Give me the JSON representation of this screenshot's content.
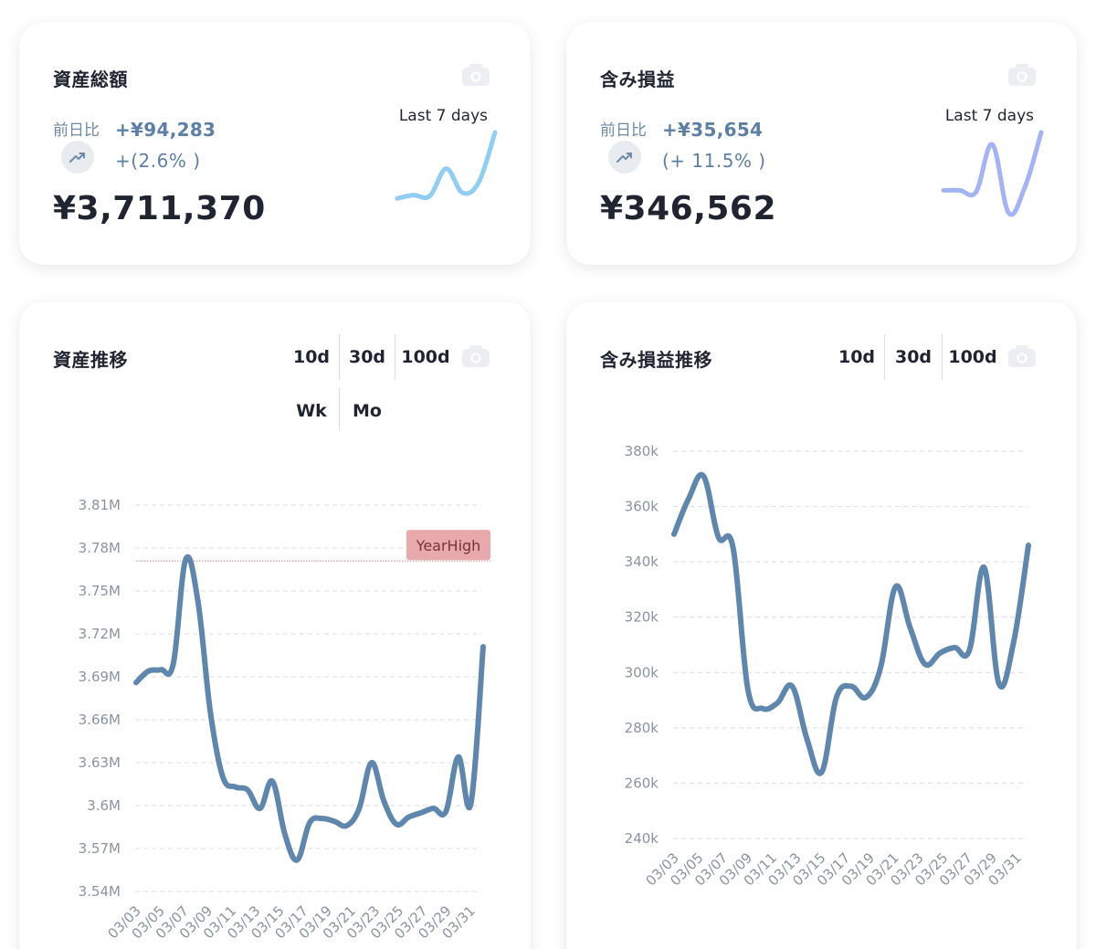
{
  "cards": {
    "assets": {
      "title": "資産総額",
      "delta_label": "前日比",
      "delta_value": "+¥94,283",
      "delta_pct": "+(2.6% )",
      "value": "¥3,711,370",
      "spark_label": "Last 7 days",
      "spark_color": "#90cdf4",
      "spark_values": [
        0.18,
        0.22,
        0.21,
        0.55,
        0.25,
        0.38,
        1.0
      ]
    },
    "pl": {
      "title": "含み損益",
      "delta_label": "前日比",
      "delta_value": "+¥35,654",
      "delta_pct": "(+ 11.5% )",
      "value": "¥346,562",
      "spark_label": "Last 7 days",
      "spark_color": "#a3b3f5",
      "spark_values": [
        0.28,
        0.28,
        0.26,
        0.85,
        0.0,
        0.32,
        1.0
      ]
    }
  },
  "assets_trend": {
    "title": "資産推移",
    "ranges": [
      "10d",
      "30d",
      "100d"
    ],
    "periods": [
      "Wk",
      "Mo"
    ],
    "annotation": "YearHigh"
  },
  "pl_trend": {
    "title": "含み損益推移",
    "ranges": [
      "10d",
      "30d",
      "100d"
    ]
  },
  "icons": {
    "camera": "camera-icon",
    "trend": "trending-up-icon"
  },
  "colors": {
    "line": "#5f86ad",
    "grid": "#d8dce2",
    "year_high_box": "#e8a9ad"
  },
  "chart_data": [
    {
      "type": "line",
      "x": [
        "03/03",
        "03/04",
        "03/05",
        "03/06",
        "03/07",
        "03/08",
        "03/09",
        "03/10",
        "03/11",
        "03/12",
        "03/13",
        "03/14",
        "03/15",
        "03/16",
        "03/17",
        "03/18",
        "03/19",
        "03/20",
        "03/21",
        "03/22",
        "03/23",
        "03/24",
        "03/25",
        "03/26",
        "03/27",
        "03/28",
        "03/29",
        "03/30",
        "03/31"
      ],
      "xticks": [
        "03/03",
        "03/05",
        "03/07",
        "03/09",
        "03/11",
        "03/13",
        "03/15",
        "03/17",
        "03/19",
        "03/21",
        "03/23",
        "03/25",
        "03/27",
        "03/29",
        "03/31"
      ],
      "values": [
        3686000,
        3694000,
        3695000,
        3699000,
        3772000,
        3742000,
        3665000,
        3620000,
        3613000,
        3611000,
        3598000,
        3617000,
        3580000,
        3562000,
        3588000,
        3591000,
        3589000,
        3586000,
        3598000,
        3630000,
        3603000,
        3587000,
        3592000,
        3595000,
        3598000,
        3596000,
        3634000,
        3601000,
        3711000
      ],
      "yticks": [
        "3.81M",
        "3.78M",
        "3.75M",
        "3.72M",
        "3.69M",
        "3.66M",
        "3.63M",
        "3.6M",
        "3.57M",
        "3.54M"
      ],
      "ylim": [
        3540000,
        3810000
      ],
      "reference_line": {
        "label": "YearHigh",
        "value": 3771000
      },
      "grid": true
    },
    {
      "type": "line",
      "x": [
        "03/03",
        "03/04",
        "03/05",
        "03/06",
        "03/07",
        "03/08",
        "03/09",
        "03/10",
        "03/11",
        "03/12",
        "03/13",
        "03/14",
        "03/15",
        "03/16",
        "03/17",
        "03/18",
        "03/19",
        "03/20",
        "03/21",
        "03/22",
        "03/23",
        "03/24",
        "03/25",
        "03/26",
        "03/27",
        "03/28",
        "03/29",
        "03/30",
        "03/31"
      ],
      "xticks": [
        "03/03",
        "03/05",
        "03/07",
        "03/09",
        "03/11",
        "03/13",
        "03/15",
        "03/17",
        "03/19",
        "03/21",
        "03/23",
        "03/25",
        "03/27",
        "03/29",
        "03/31"
      ],
      "values": [
        350000,
        363000,
        371000,
        349000,
        345000,
        294000,
        287000,
        289000,
        295000,
        276000,
        264000,
        291000,
        295000,
        291000,
        302000,
        331000,
        316000,
        303000,
        307000,
        309000,
        308000,
        338000,
        296000,
        311000,
        346000
      ],
      "yticks": [
        "380k",
        "360k",
        "340k",
        "320k",
        "300k",
        "280k",
        "260k",
        "240k"
      ],
      "ylim": [
        240000,
        380000
      ],
      "grid": true
    }
  ]
}
